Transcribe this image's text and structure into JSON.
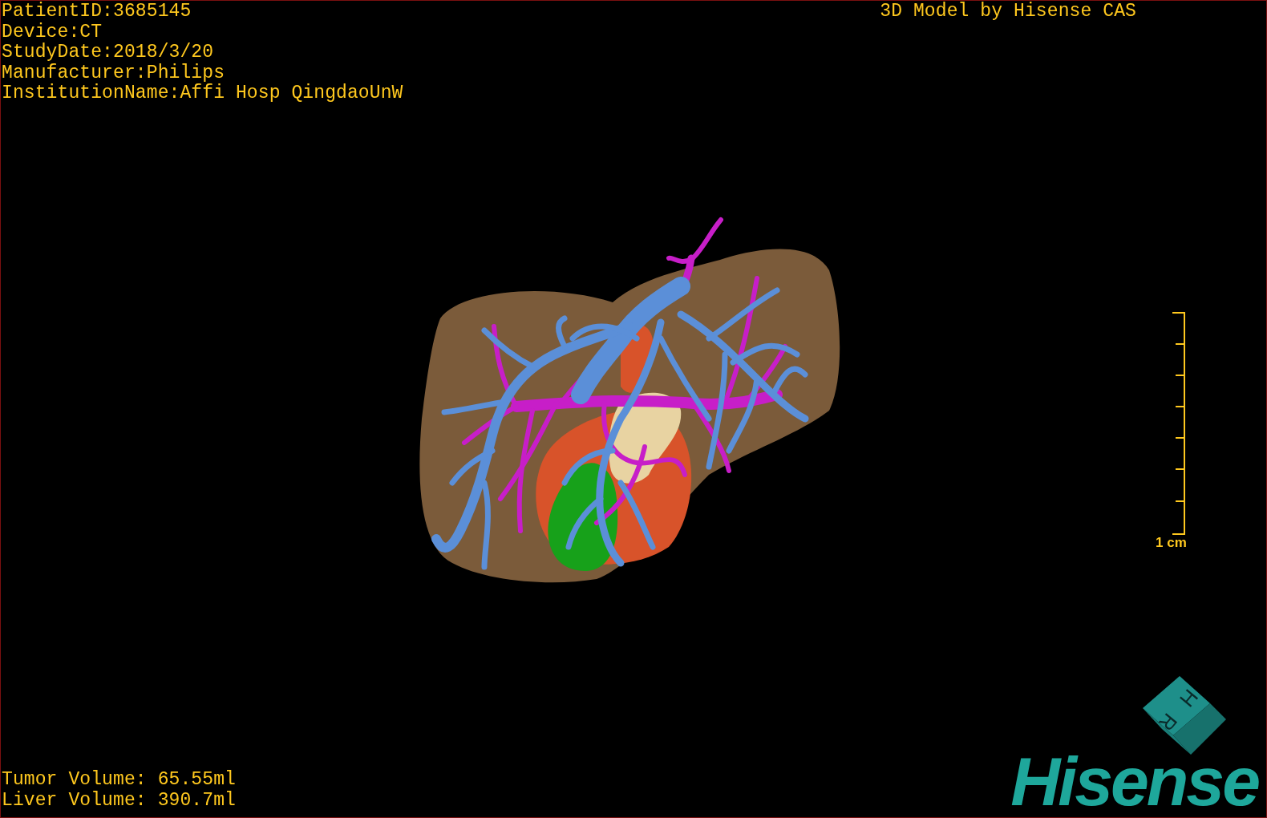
{
  "study_info": [
    "PatientID:3685145",
    "Device:CT",
    "StudyDate:2018/3/20",
    "Manufacturer:Philips",
    "InstitutionName:Affi Hosp QingdaoUnW"
  ],
  "title": "3D Model by Hisense CAS",
  "scale_bar": {
    "label": "1 cm"
  },
  "volumes": [
    "Tumor Volume: 65.55ml",
    "Liver Volume: 390.7ml"
  ],
  "orientation_cube": {
    "faces": [
      "H",
      "R"
    ]
  },
  "logo": "Hisense"
}
